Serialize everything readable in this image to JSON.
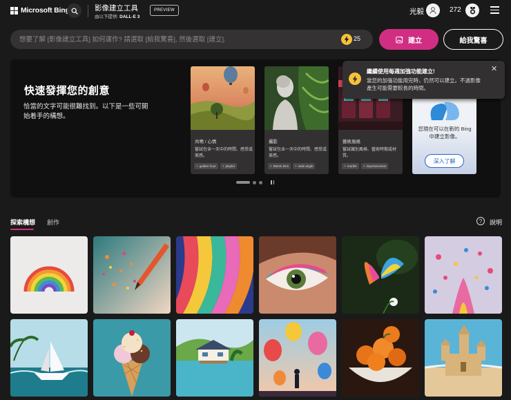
{
  "header": {
    "brand": "Microsoft Bing",
    "app_title": "影像建立工具",
    "provided_by": "由以下提供:",
    "provider": "DALL·E 3",
    "preview_badge": "PREVIEW",
    "user_name": "光毅",
    "reward_points": "272",
    "icons": [
      "windows-logo-icon",
      "search-icon",
      "avatar-icon",
      "rewards-medal-icon",
      "menu-icon"
    ]
  },
  "prompt": {
    "placeholder": "想要了解 [影像建立工具] 如何運作? 請選取 [給我驚喜], 然後選取 [建立].",
    "boost_count": "25",
    "create_label": "建立",
    "surprise_label": "給我驚喜"
  },
  "hero": {
    "title": "快速發揮您的創意",
    "text": "恰當的文字可能很難找到。以下是一些可開始着手的構想。",
    "cards": [
      {
        "title": "共鳴 / 心情",
        "desc": "嘗試包含一天中的時間、感受或美感。",
        "tags": [
          "golden hour",
          "playful"
        ]
      },
      {
        "title": "攝影",
        "desc": "嘗試包含一天中的時間、感受或美感。",
        "tags": [
          "85mm lens",
          "wide angle"
        ]
      },
      {
        "title": "藝術風格",
        "desc": "嘗試識別風格、藝術時期或材質。",
        "tags": [
          "marble",
          "impressionism"
        ]
      }
    ],
    "bing_card": {
      "notice": "您現在可以在新的 Bing 中建立影像。",
      "learn_more": "深入了解"
    }
  },
  "tooltip": {
    "title": "繼續使用每週加強功能建立!",
    "body": "當您的加強功能用完時，仍然可以建立。不過影像產生可能需要較長的時間。",
    "close": "✕"
  },
  "tabs": {
    "explore": "探索構想",
    "create": "創作",
    "help": "說明"
  },
  "gallery": {
    "images": [
      "rainbow",
      "colored-pencil",
      "ribbons",
      "eye-makeup",
      "butterfly",
      "splash",
      "paper-boat",
      "ice-cream",
      "lake-house",
      "balloons",
      "oranges",
      "sandcastle"
    ]
  },
  "colors": {
    "background": "#1b1a1a",
    "accent_pink": "#d12e83",
    "boost_yellow": "#f5c23a",
    "field_gray": "#343232",
    "link_blue": "#2a63c4"
  }
}
